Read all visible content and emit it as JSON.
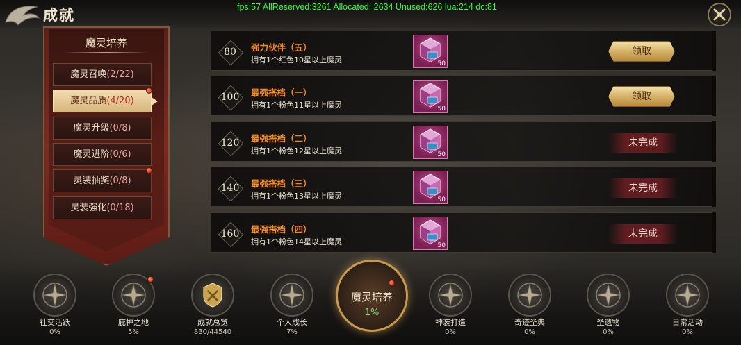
{
  "window": {
    "title": "成就",
    "debug": "fps:57 AllReserved:3261 Allocated: 2634 Unused:626 lua:214 dc:81"
  },
  "sidebar": {
    "title": "魔灵培养",
    "items": [
      {
        "name": "魔灵召唤",
        "count": "(2/22)",
        "active": false,
        "dot": false
      },
      {
        "name": "魔灵品质",
        "count": "(4/20)",
        "active": true,
        "dot": true
      },
      {
        "name": "魔灵升级",
        "count": "(0/8)",
        "active": false,
        "dot": false
      },
      {
        "name": "魔灵进阶",
        "count": "(0/6)",
        "active": false,
        "dot": false
      },
      {
        "name": "灵装抽奖",
        "count": "(0/8)",
        "active": false,
        "dot": true
      },
      {
        "name": "灵装强化",
        "count": "(0/18)",
        "active": false,
        "dot": false
      }
    ]
  },
  "tasks": [
    {
      "score": "80",
      "name": "强力伙伴（五）",
      "desc": "拥有1个红色10星以上魔灵",
      "reward_count": "50",
      "status": "领取",
      "claimable": true
    },
    {
      "score": "100",
      "name": "最强搭档（一）",
      "desc": "拥有1个粉色11星以上魔灵",
      "reward_count": "50",
      "status": "领取",
      "claimable": true
    },
    {
      "score": "120",
      "name": "最强搭档（二）",
      "desc": "拥有1个粉色12星以上魔灵",
      "reward_count": "50",
      "status": "未完成",
      "claimable": false
    },
    {
      "score": "140",
      "name": "最强搭档（三）",
      "desc": "拥有1个粉色13星以上魔灵",
      "reward_count": "50",
      "status": "未完成",
      "claimable": false
    },
    {
      "score": "160",
      "name": "最强搭档（四）",
      "desc": "拥有1个粉色14星以上魔灵",
      "reward_count": "50",
      "status": "未完成",
      "claimable": false
    }
  ],
  "bottom_nav": [
    {
      "label": "社交活跃",
      "pct": "0%",
      "dot": false,
      "icon": "star-compass-icon"
    },
    {
      "label": "庇护之地",
      "pct": "5%",
      "dot": true,
      "icon": "star-compass-icon"
    },
    {
      "label": "成就总览",
      "pct": "830/44540",
      "dot": false,
      "icon": "gold-crest-icon"
    },
    {
      "label": "个人成长",
      "pct": "7%",
      "dot": false,
      "icon": "star-compass-icon"
    },
    {
      "label": "神装打造",
      "pct": "0%",
      "dot": false,
      "icon": "star-compass-icon"
    },
    {
      "label": "奇迹圣典",
      "pct": "0%",
      "dot": false,
      "icon": "star-compass-icon"
    },
    {
      "label": "圣遗物",
      "pct": "0%",
      "dot": false,
      "icon": "star-compass-icon"
    },
    {
      "label": "日常活动",
      "pct": "0%",
      "dot": false,
      "icon": "star-compass-icon"
    }
  ],
  "center_nav": {
    "label": "魔灵培养",
    "pct": "1%",
    "dot": true
  },
  "colors": {
    "accent_gold": "#d2ad62",
    "task_name": "#f08a2a",
    "progress_green": "#7ee07a",
    "notice_red": "#c0200c"
  }
}
